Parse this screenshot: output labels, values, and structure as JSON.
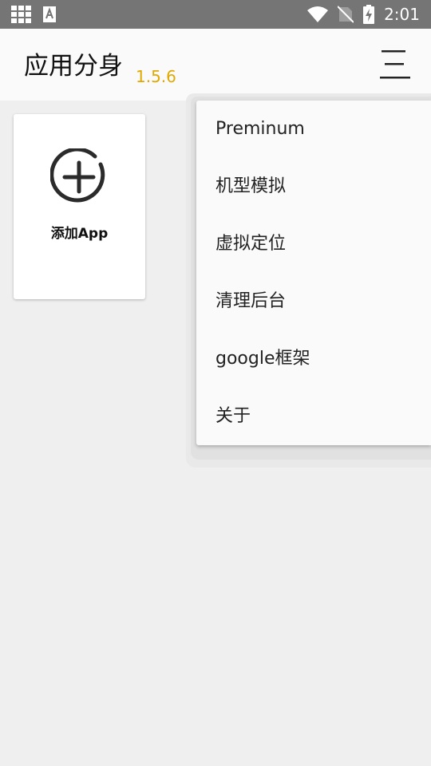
{
  "status_bar": {
    "time": "2:01",
    "left_icons": [
      "grid-icon",
      "keyboard-a-icon"
    ],
    "right_icons": [
      "wifi-icon",
      "no-sim-icon",
      "battery-charging-icon"
    ]
  },
  "app_bar": {
    "title": "应用分身",
    "version": "1.5.6",
    "version_color": "#e0a800",
    "menu_icon": "menu-icon"
  },
  "add_card": {
    "label": "添加App",
    "icon": "add-circle-icon"
  },
  "menu": {
    "items": [
      {
        "label": "Preminum"
      },
      {
        "label": "机型模拟"
      },
      {
        "label": "虚拟定位"
      },
      {
        "label": "清理后台"
      },
      {
        "label": "google框架"
      },
      {
        "label": "关于"
      }
    ]
  }
}
